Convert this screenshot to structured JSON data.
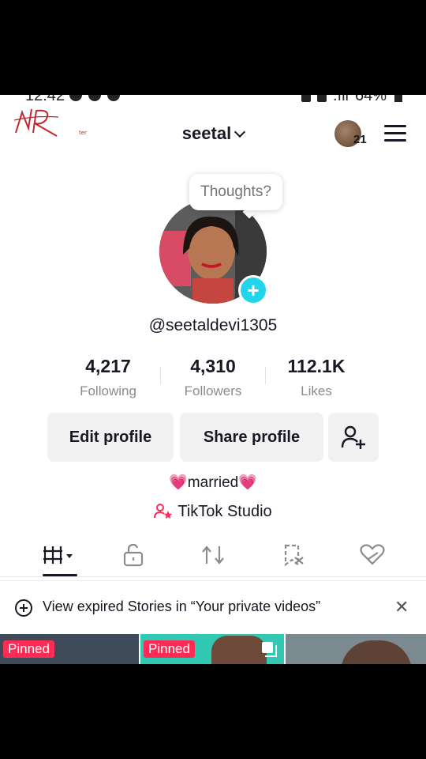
{
  "status_bar": {
    "time": "12:42",
    "battery": "64%"
  },
  "profile": {
    "display_name": "seetal",
    "notification_count": "21",
    "thoughts_prompt": "Thoughts?",
    "username": "@seetaldevi1305",
    "bio": "💗married💗",
    "studio_label": "TikTok Studio"
  },
  "stats": [
    {
      "value": "4,217",
      "label": "Following"
    },
    {
      "value": "4,310",
      "label": "Followers"
    },
    {
      "value": "112.1K",
      "label": "Likes"
    }
  ],
  "buttons": {
    "edit": "Edit profile",
    "share": "Share profile"
  },
  "tabs": [
    "videos-grid-icon",
    "private-lock-icon",
    "repost-icon",
    "favorites-icon",
    "liked-heart-icon"
  ],
  "banner": {
    "text": "View expired Stories in “Your private videos”"
  },
  "thumbnails": [
    {
      "badge": "Pinned",
      "color": "#3e4a57"
    },
    {
      "badge": "Pinned",
      "color": "#32c9b4"
    },
    {
      "badge": "",
      "color": "#7a8a90"
    }
  ],
  "colors": {
    "accent": "#fe2c55",
    "add_badge": "#20d5ec"
  }
}
